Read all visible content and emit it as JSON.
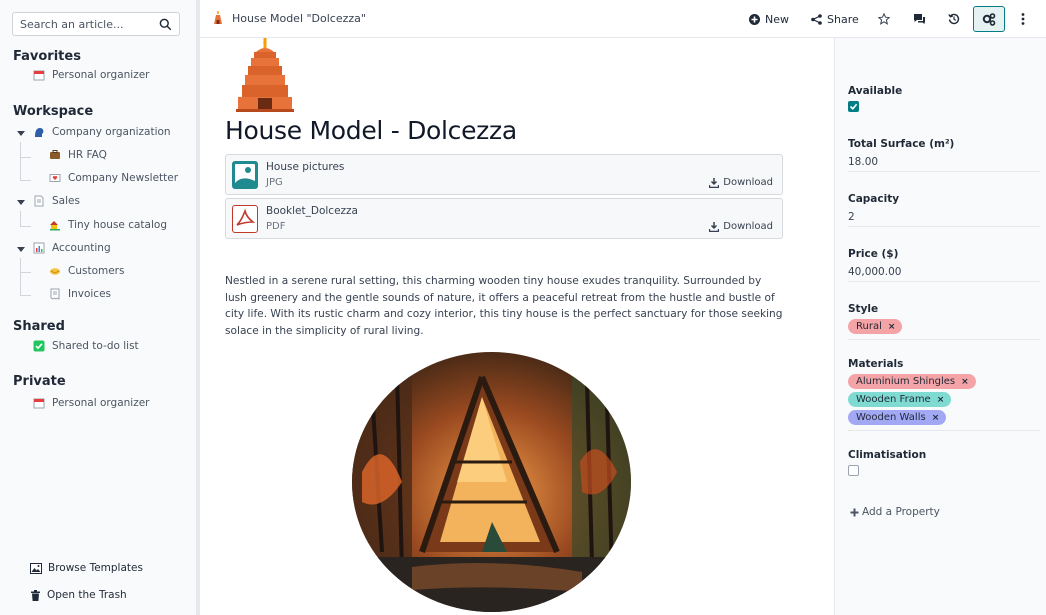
{
  "sidebar": {
    "search_placeholder": "Search an article...",
    "favorites_title": "Favorites",
    "favorites": [
      {
        "label": "Personal organizer"
      }
    ],
    "workspace_title": "Workspace",
    "workspace": [
      {
        "label": "Company organization"
      },
      {
        "label": "HR FAQ"
      },
      {
        "label": "Company Newsletter"
      },
      {
        "label": "Sales"
      },
      {
        "label": "Tiny house catalog"
      },
      {
        "label": "Accounting"
      },
      {
        "label": "Customers"
      },
      {
        "label": "Invoices"
      }
    ],
    "shared_title": "Shared",
    "shared": [
      {
        "label": "Shared to-do list"
      }
    ],
    "private_title": "Private",
    "private": [
      {
        "label": "Personal organizer"
      }
    ],
    "browse_templates": "Browse Templates",
    "open_trash": "Open the Trash"
  },
  "topbar": {
    "breadcrumb": "House Model \"Dolcezza\"",
    "new_label": "New",
    "share_label": "Share"
  },
  "article": {
    "title": "House Model - Dolcezza",
    "files": [
      {
        "name": "House pictures",
        "type": "JPG",
        "download": "Download"
      },
      {
        "name": "Booklet_Dolcezza",
        "type": "PDF",
        "download": "Download"
      }
    ],
    "body": "Nestled in a serene rural setting, this charming wooden tiny house exudes tranquility. Surrounded by lush greenery and the gentle sounds of nature, it offers a peaceful retreat from the hustle and bustle of city life. With its rustic charm and cozy interior, this tiny house is the perfect sanctuary for those seeking solace in the simplicity of rural living."
  },
  "properties": {
    "available_label": "Available",
    "available": true,
    "surface_label": "Total Surface (m²)",
    "surface": "18.00",
    "capacity_label": "Capacity",
    "capacity": "2",
    "price_label": "Price ($)",
    "price": "40,000.00",
    "style_label": "Style",
    "style_tags": [
      {
        "label": "Rural",
        "color": "#f4a3a6"
      }
    ],
    "materials_label": "Materials",
    "materials_tags": [
      {
        "label": "Aluminium Shingles",
        "color": "#f4a3a6"
      },
      {
        "label": "Wooden Frame",
        "color": "#7fdbd2"
      },
      {
        "label": "Wooden Walls",
        "color": "#a3a8f4"
      }
    ],
    "climatisation_label": "Climatisation",
    "climatisation": false,
    "add_property": "Add a Property"
  },
  "colors": {
    "accent": "#017e84"
  }
}
